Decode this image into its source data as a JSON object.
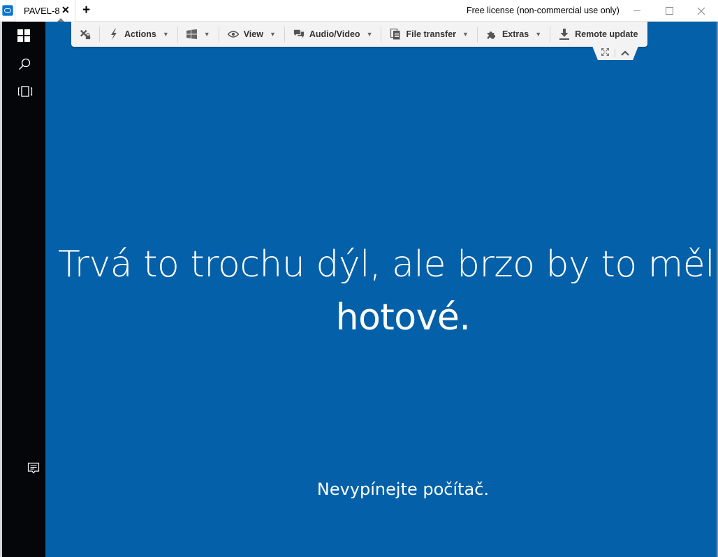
{
  "titlebar": {
    "app_icon": "teamviewer-icon",
    "tab": {
      "label": "PAVEL-8",
      "close_icon": "close-icon",
      "active": true
    },
    "new_tab_icon": "plus-icon",
    "license_text": "Free license (non-commercial use only)",
    "window_controls": {
      "minimize": "minimize-icon",
      "maximize": "maximize-icon",
      "close": "close-icon"
    }
  },
  "toolbar": {
    "items": [
      {
        "id": "end-session",
        "icon": "disconnect-lock-icon",
        "label": "",
        "has_dropdown": false
      },
      {
        "id": "actions",
        "icon": "lightning-icon",
        "label": "Actions",
        "has_dropdown": true
      },
      {
        "id": "windows",
        "icon": "windows-icon",
        "label": "",
        "has_dropdown": true
      },
      {
        "id": "view",
        "icon": "eye-icon",
        "label": "View",
        "has_dropdown": true
      },
      {
        "id": "audio-video",
        "icon": "chat-bubbles-icon",
        "label": "Audio/Video",
        "has_dropdown": true
      },
      {
        "id": "file-transfer",
        "icon": "files-icon",
        "label": "File transfer",
        "has_dropdown": true
      },
      {
        "id": "extras",
        "icon": "puzzle-icon",
        "label": "Extras",
        "has_dropdown": true
      },
      {
        "id": "remote-update",
        "icon": "download-icon",
        "label": "Remote update",
        "has_dropdown": false
      }
    ],
    "tab": {
      "fullscreen_icon": "fullscreen-icon",
      "collapse_icon": "chevron-up-icon"
    }
  },
  "sidebar": {
    "items": [
      {
        "icon": "windows-start-icon"
      },
      {
        "icon": "search-icon"
      },
      {
        "icon": "task-view-icon"
      },
      {
        "icon": "notification-icon"
      }
    ]
  },
  "remote_screen": {
    "background_color": "#0460a8",
    "message_line1": "Trvá to trochu dýl, ale brzo by to mělo být",
    "message_line2": "hotové.",
    "footer_message": "Nevypínejte počítač."
  }
}
